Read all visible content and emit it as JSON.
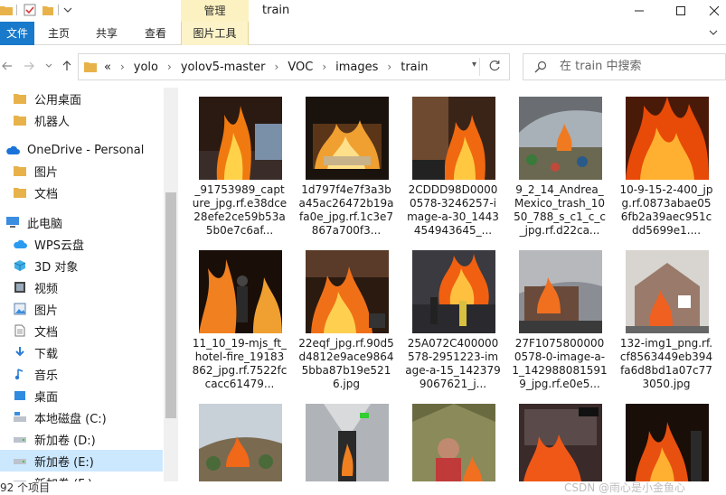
{
  "titlebar": {
    "context_tab_top": "管理",
    "title": "train"
  },
  "ribbon": {
    "tabs": [
      {
        "label": "文件"
      },
      {
        "label": "主页"
      },
      {
        "label": "共享"
      },
      {
        "label": "查看"
      },
      {
        "label": "图片工具"
      }
    ]
  },
  "address": {
    "crumbs": [
      "«",
      "yolo",
      "yolov5-master",
      "VOC",
      "images",
      "train"
    ]
  },
  "search": {
    "placeholder": "在 train 中搜索"
  },
  "sidebar": {
    "items": [
      {
        "label": "公用桌面",
        "icon": "folder-icon"
      },
      {
        "label": "机器人",
        "icon": "folder-icon"
      },
      {
        "label": "OneDrive - Personal",
        "icon": "cloud-icon"
      },
      {
        "label": "图片",
        "icon": "folder-icon"
      },
      {
        "label": "文档",
        "icon": "folder-icon"
      },
      {
        "label": "此电脑",
        "icon": "computer-icon"
      },
      {
        "label": "WPS云盘",
        "icon": "wps-cloud-icon"
      },
      {
        "label": "3D 对象",
        "icon": "cube-icon"
      },
      {
        "label": "视频",
        "icon": "video-icon"
      },
      {
        "label": "图片",
        "icon": "picture-icon"
      },
      {
        "label": "文档",
        "icon": "document-icon"
      },
      {
        "label": "下载",
        "icon": "download-icon"
      },
      {
        "label": "音乐",
        "icon": "music-icon"
      },
      {
        "label": "桌面",
        "icon": "desktop-icon"
      },
      {
        "label": "本地磁盘 (C:)",
        "icon": "system-drive-icon"
      },
      {
        "label": "新加卷 (D:)",
        "icon": "drive-icon"
      },
      {
        "label": "新加卷 (E:)",
        "icon": "drive-icon"
      },
      {
        "label": "新加卷 (F:)",
        "icon": "drive-icon"
      }
    ]
  },
  "files": [
    {
      "caption": "_91753989_capture_jpg.rf.e38dce28efe2ce59b53a5b0e7c6af...",
      "scene": "night-fire"
    },
    {
      "caption": "1d797f4e7f3a3ba45ac26472b19afa0e_jpg.rf.1c3e7867a700f3...",
      "scene": "room-fire"
    },
    {
      "caption": "2CDDD98D00000578-3246257-image-a-30_1443454943645_...",
      "scene": "living-room-fire"
    },
    {
      "caption": "9_2_14_Andrea_Mexico_trash_1050_788_s_c1_c_c_jpg.rf.d22ca...",
      "scene": "trash-fire"
    },
    {
      "caption": "10-9-15-2-400_jpg.rf.0873abae056fb2a39aec951cdd5699e1....",
      "scene": "big-fire"
    },
    {
      "caption": "11_10_19-mjs_ft_hotel-fire_19183862_jpg.rf.7522fccacc61479...",
      "scene": "firefighter-door"
    },
    {
      "caption": "22eqf_jpg.rf.90d5d4812e9ace98645bba87b19e5216.jpg",
      "scene": "room-fire-2"
    },
    {
      "caption": "25A072C400000578-2951223-image-a-15_1423799067621_j...",
      "scene": "firefighters-hose"
    },
    {
      "caption": "27F10758000000578-0-image-a-1_1429880815919_jpg.rf.e0e5...",
      "scene": "house-fire"
    },
    {
      "caption": "132-img1_png.rf.cf8563449eb394fa6d8bd1a07c773050.jpg",
      "scene": "house-smoke"
    },
    {
      "caption": "",
      "scene": "hill-fire"
    },
    {
      "caption": "",
      "scene": "corridor-fire"
    },
    {
      "caption": "",
      "scene": "person-tent"
    },
    {
      "caption": "",
      "scene": "shop-fire"
    },
    {
      "caption": "",
      "scene": "dark-fire"
    }
  ],
  "status": {
    "count": "92 个项目",
    "watermark": "CSDN @雨心是小金鱼心"
  },
  "colors": {
    "accent": "#1979ca",
    "selected": "#cce8ff",
    "context_tab": "#fcf1c0"
  }
}
